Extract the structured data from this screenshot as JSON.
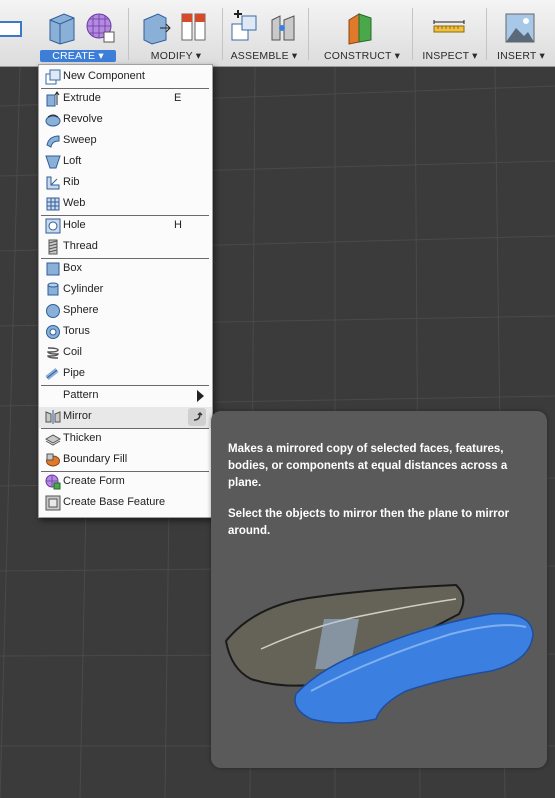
{
  "toolbar": {
    "groups": [
      {
        "label": "CREATE ▾"
      },
      {
        "label": "MODIFY ▾"
      },
      {
        "label": "ASSEMBLE ▾"
      },
      {
        "label": "CONSTRUCT ▾"
      },
      {
        "label": "INSPECT ▾"
      },
      {
        "label": "INSERT ▾"
      }
    ]
  },
  "menu": {
    "items": [
      {
        "label": "New Component",
        "shortcut": ""
      },
      {
        "label": "Extrude",
        "shortcut": "E"
      },
      {
        "label": "Revolve",
        "shortcut": ""
      },
      {
        "label": "Sweep",
        "shortcut": ""
      },
      {
        "label": "Loft",
        "shortcut": ""
      },
      {
        "label": "Rib",
        "shortcut": ""
      },
      {
        "label": "Web",
        "shortcut": ""
      },
      {
        "label": "Hole",
        "shortcut": "H"
      },
      {
        "label": "Thread",
        "shortcut": ""
      },
      {
        "label": "Box",
        "shortcut": ""
      },
      {
        "label": "Cylinder",
        "shortcut": ""
      },
      {
        "label": "Sphere",
        "shortcut": ""
      },
      {
        "label": "Torus",
        "shortcut": ""
      },
      {
        "label": "Coil",
        "shortcut": ""
      },
      {
        "label": "Pipe",
        "shortcut": ""
      },
      {
        "label": "Pattern",
        "shortcut": ""
      },
      {
        "label": "Mirror",
        "shortcut": ""
      },
      {
        "label": "Thicken",
        "shortcut": ""
      },
      {
        "label": "Boundary Fill",
        "shortcut": ""
      },
      {
        "label": "Create Form",
        "shortcut": ""
      },
      {
        "label": "Create Base Feature",
        "shortcut": ""
      }
    ]
  },
  "tooltip": {
    "description": "Makes a mirrored copy of selected faces, features, bodies, or components at equal distances across a plane.",
    "instruction": "Select the objects to mirror then the plane to mirror around."
  },
  "colors": {
    "accent": "#3d7fd8",
    "canvas": "#3b3b3b",
    "tooltip_bg": "#5a5a5a",
    "mirror_body": "#3b7fe0"
  }
}
